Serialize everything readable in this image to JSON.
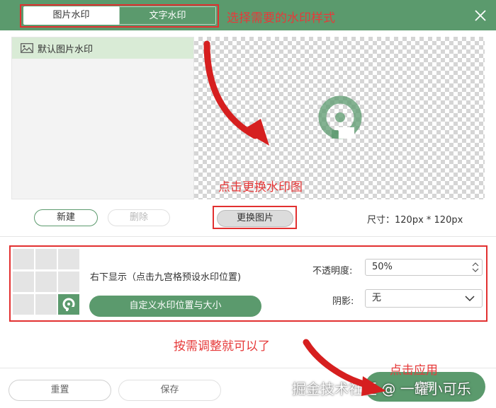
{
  "tabs": [
    {
      "label": "图片水印",
      "active": true
    },
    {
      "label": "文字水印",
      "active": false
    }
  ],
  "annotations": {
    "select_type": "选择需要的水印样式",
    "change_image": "点击更换水印图",
    "adjust": "按需调整就可以了",
    "apply": "点击应用"
  },
  "list": {
    "items": [
      {
        "label": "默认图片水印",
        "icon": "image-icon"
      }
    ]
  },
  "buttons": {
    "new": "新建",
    "delete": "删除",
    "change_image": "更换图片",
    "custom_position": "自定义水印位置与大小",
    "reset": "重置",
    "save": "保存",
    "apply": "应用"
  },
  "size_label": "尺寸：120px * 120px",
  "position_text": "右下显示（点击九宫格预设水印位置)",
  "opacity": {
    "label": "不透明度:",
    "value": "50%"
  },
  "shadow": {
    "label": "阴影:",
    "value": "无"
  },
  "grid": {
    "selected_index": 8,
    "selected_icon": "watermark-logo-icon"
  },
  "site_watermark": "掘金技术社区 @ 一罐小可乐",
  "colors": {
    "accent": "#5b9a6d",
    "annotation": "#e63a3a",
    "list_highlight": "#d9ebd6"
  }
}
